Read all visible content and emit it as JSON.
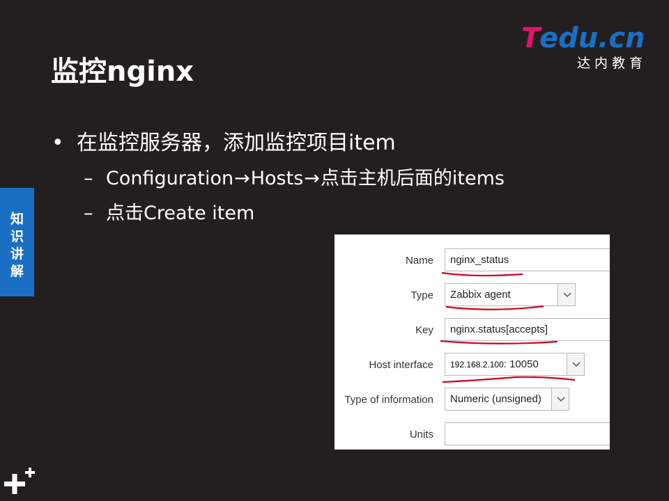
{
  "brand": {
    "logo_text": "Tedu.cn",
    "logo_subtitle": "达内教育",
    "colors": {
      "pink": "#e2136e",
      "blue": "#1a6fc4"
    }
  },
  "slide": {
    "title": "监控nginx",
    "bullet": "在监控服务器，添加监控项目item",
    "sub_items": [
      {
        "dash": "–",
        "parts": [
          "Configuration",
          "Hosts",
          "点击主机后面的items"
        ]
      },
      {
        "dash": "–",
        "text": "点击Create item"
      }
    ],
    "arrow_glyph": "→"
  },
  "side_tab": {
    "chars": [
      "知",
      "识",
      "讲",
      "解"
    ]
  },
  "decorations": {
    "plus_icon": "plus-icon"
  },
  "form": {
    "fields": [
      {
        "label": "Name",
        "value": "nginx_status"
      },
      {
        "label": "Type",
        "value": "Zabbix agent"
      },
      {
        "label": "Key",
        "value": "nginx.status[accepts]"
      },
      {
        "label": "Host interface",
        "ip": "192.168.2.100",
        "port": ": 10050"
      },
      {
        "label": "Type of information",
        "value": "Numeric (unsigned)"
      },
      {
        "label": "Units",
        "value": ""
      }
    ],
    "annotation_color": "#d0021b"
  }
}
